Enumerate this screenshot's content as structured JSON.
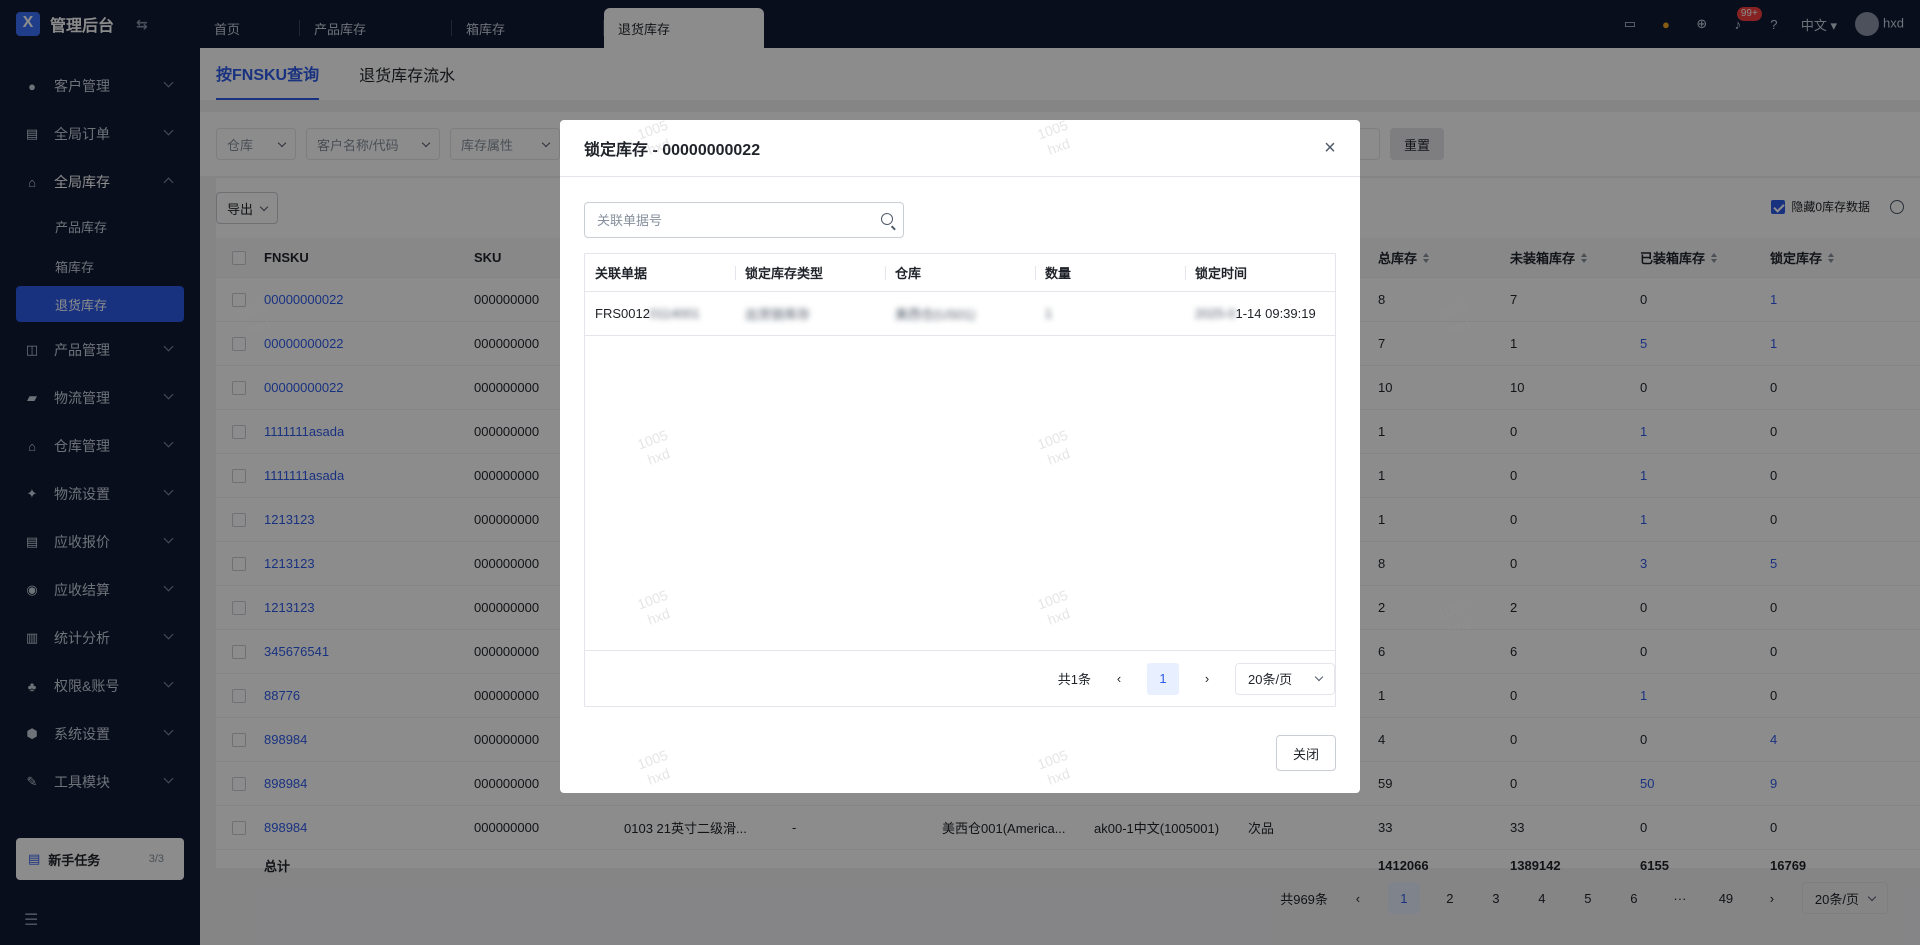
{
  "app": {
    "title": "管理后台"
  },
  "tabs": [
    "首页",
    "产品库存",
    "箱库存",
    "退货库存"
  ],
  "topbar": {
    "badge": "99+",
    "language": "中文",
    "user": "hxd"
  },
  "sidebar": {
    "items": [
      {
        "label": "客户管理",
        "icon": "customer-icon"
      },
      {
        "label": "全局订单",
        "icon": "order-icon"
      },
      {
        "label": "全局库存",
        "icon": "warehouse-icon",
        "expanded": true,
        "children": [
          "产品库存",
          "箱库存",
          "退货库存"
        ]
      },
      {
        "label": "产品管理",
        "icon": "product-icon"
      },
      {
        "label": "物流管理",
        "icon": "truck-icon"
      },
      {
        "label": "仓库管理",
        "icon": "house-icon"
      },
      {
        "label": "物流设置",
        "icon": "settings-icon"
      },
      {
        "label": "应收报价",
        "icon": "quote-icon"
      },
      {
        "label": "应收结算",
        "icon": "coin-icon"
      },
      {
        "label": "统计分析",
        "icon": "chart-icon"
      },
      {
        "label": "权限&账号",
        "icon": "org-icon"
      },
      {
        "label": "系统设置",
        "icon": "gear-icon"
      },
      {
        "label": "工具模块",
        "icon": "wrench-icon"
      }
    ],
    "task": {
      "label": "新手任务",
      "count": "3/3"
    }
  },
  "subtabs": [
    "按FNSKU查询",
    "退货库存流水"
  ],
  "filters": {
    "warehouse": "仓库",
    "customer": "客户名称/代码",
    "attr": "库存属性",
    "reset": "重置"
  },
  "toolbar": {
    "export": "导出",
    "hide_zero": "隐藏0库存数据"
  },
  "grid": {
    "headers": {
      "fnsku": "FNSKU",
      "sku": "SKU",
      "total": "总库存",
      "unboxed": "未装箱库存",
      "boxed": "已装箱库存",
      "locked": "锁定库存"
    },
    "rows": [
      {
        "fnsku": "00000000022",
        "sku": "000000000",
        "total": "8",
        "unboxed": "7",
        "boxed": "0",
        "locked": "1"
      },
      {
        "fnsku": "00000000022",
        "sku": "000000000",
        "total": "7",
        "unboxed": "1",
        "boxed": "5",
        "locked": "1"
      },
      {
        "fnsku": "00000000022",
        "sku": "000000000",
        "total": "10",
        "unboxed": "10",
        "boxed": "0",
        "locked": "0"
      },
      {
        "fnsku": "1111111asada",
        "sku": "000000000",
        "total": "1",
        "unboxed": "0",
        "boxed": "1",
        "locked": "0"
      },
      {
        "fnsku": "1111111asada",
        "sku": "000000000",
        "total": "1",
        "unboxed": "0",
        "boxed": "1",
        "locked": "0"
      },
      {
        "fnsku": "1213123",
        "sku": "000000000",
        "total": "1",
        "unboxed": "0",
        "boxed": "1",
        "locked": "0"
      },
      {
        "fnsku": "1213123",
        "sku": "000000000",
        "total": "8",
        "unboxed": "0",
        "boxed": "3",
        "locked": "5"
      },
      {
        "fnsku": "1213123",
        "sku": "000000000",
        "total": "2",
        "unboxed": "2",
        "boxed": "0",
        "locked": "0"
      },
      {
        "fnsku": "345676541",
        "sku": "000000000",
        "total": "6",
        "unboxed": "6",
        "boxed": "0",
        "locked": "0"
      },
      {
        "fnsku": "88776",
        "sku": "000000000",
        "total": "1",
        "unboxed": "0",
        "boxed": "1",
        "locked": "0"
      },
      {
        "fnsku": "898984",
        "sku": "000000000",
        "total": "4",
        "unboxed": "0",
        "boxed": "0",
        "locked": "4"
      },
      {
        "fnsku": "898984",
        "sku": "000000000",
        "total": "59",
        "unboxed": "0",
        "boxed": "50",
        "locked": "9"
      },
      {
        "fnsku": "898984",
        "sku": "000000000",
        "name": "0103 21英寸二级滑...",
        "dash": "-",
        "warehouse": "美西仓001(America...",
        "loc": "ak00-1中文(1005001)",
        "attr": "次品",
        "total": "33",
        "unboxed": "33",
        "boxed": "0",
        "locked": "0"
      }
    ],
    "totals": {
      "label": "总计",
      "total": "1412066",
      "unboxed": "1389142",
      "boxed": "6155",
      "locked": "16769"
    }
  },
  "pager": {
    "summary": "共969条",
    "pages": [
      "1",
      "2",
      "3",
      "4",
      "5",
      "6",
      "···",
      "49"
    ],
    "size": "20条/页"
  },
  "modal": {
    "title": "锁定库存 - 00000000022",
    "search_placeholder": "关联单据号",
    "headers": [
      "关联单据",
      "锁定库存类型",
      "仓库",
      "数量",
      "锁定时间"
    ],
    "row": {
      "doc_visible": "FRS0012",
      "doc_blur": "0114001",
      "type_blur": "出货锁库存",
      "wh_blur": "美西仓(US01)",
      "qty_blur": "1",
      "time_blur": "2025-0",
      "time_visible": "1-14 09:39:19"
    },
    "pager": {
      "summary": "共1条",
      "page": "1",
      "size": "20条/页"
    },
    "close": "关闭"
  },
  "watermark": {
    "id": "1005",
    "user": "hxd"
  },
  "colors": {
    "sidebar_bg": "#0f1a33",
    "accent": "#2f5bea"
  }
}
